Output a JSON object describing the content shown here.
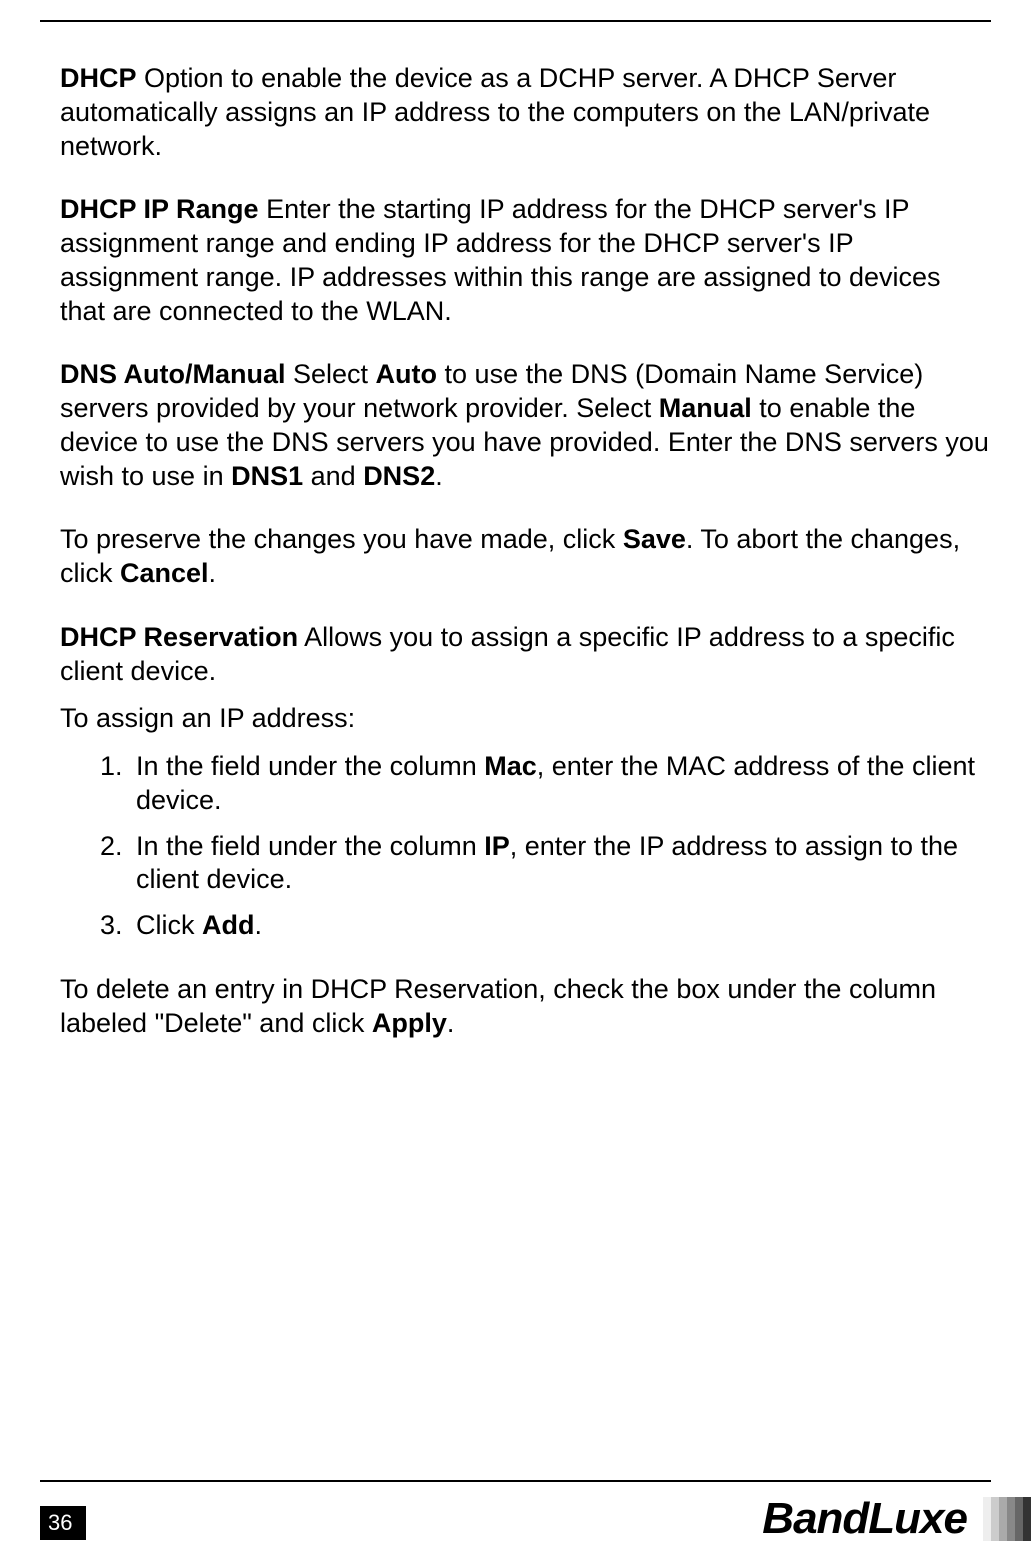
{
  "page_number": "36",
  "brand": "BandLuxe",
  "paragraphs": {
    "dhcp_label": "DHCP",
    "dhcp_text": " Option to enable the device as a DCHP server. A DHCP Server automatically assigns an IP address to the computers on the LAN/private network.",
    "dhcp_range_label": "DHCP IP Range",
    "dhcp_range_text": " Enter the starting IP address for the DHCP server's IP assignment range and ending IP address for the DHCP server's IP assignment range. IP addresses within this range are assigned to devices that are connected to the WLAN.",
    "dns_label": "DNS Auto/Manual",
    "dns_text_1": " Select ",
    "dns_auto": "Auto",
    "dns_text_2": " to use the DNS (Domain Name Service) servers provided by your network provider. Select ",
    "dns_manual": "Manual",
    "dns_text_3": " to enable the device to use the DNS servers you have provided. Enter the DNS servers you wish to use in ",
    "dns1": "DNS1",
    "dns_and": " and ",
    "dns2": "DNS2",
    "dns_period": ".",
    "save_text_1": "To preserve the changes you have made, click ",
    "save_bold": "Save",
    "save_text_2": ". To abort the changes, click ",
    "cancel_bold": "Cancel",
    "save_period": ".",
    "reservation_label": "DHCP Reservation",
    "reservation_text": " Allows you to assign a specific IP address to a specific client device.",
    "assign_intro": "To assign an IP address:",
    "step1_a": "In the field under the column ",
    "step1_mac": "Mac",
    "step1_b": ", enter the MAC address of the client device.",
    "step2_a": "In the field under the column ",
    "step2_ip": "IP",
    "step2_b": ", enter the IP address to assign to the client device.",
    "step3_a": "Click ",
    "step3_add": "Add",
    "step3_b": ".",
    "delete_text_1": "To delete an entry in DHCP Reservation, check the box under the column labeled \"Delete\" and click ",
    "apply_bold": "Apply",
    "delete_period": "."
  }
}
